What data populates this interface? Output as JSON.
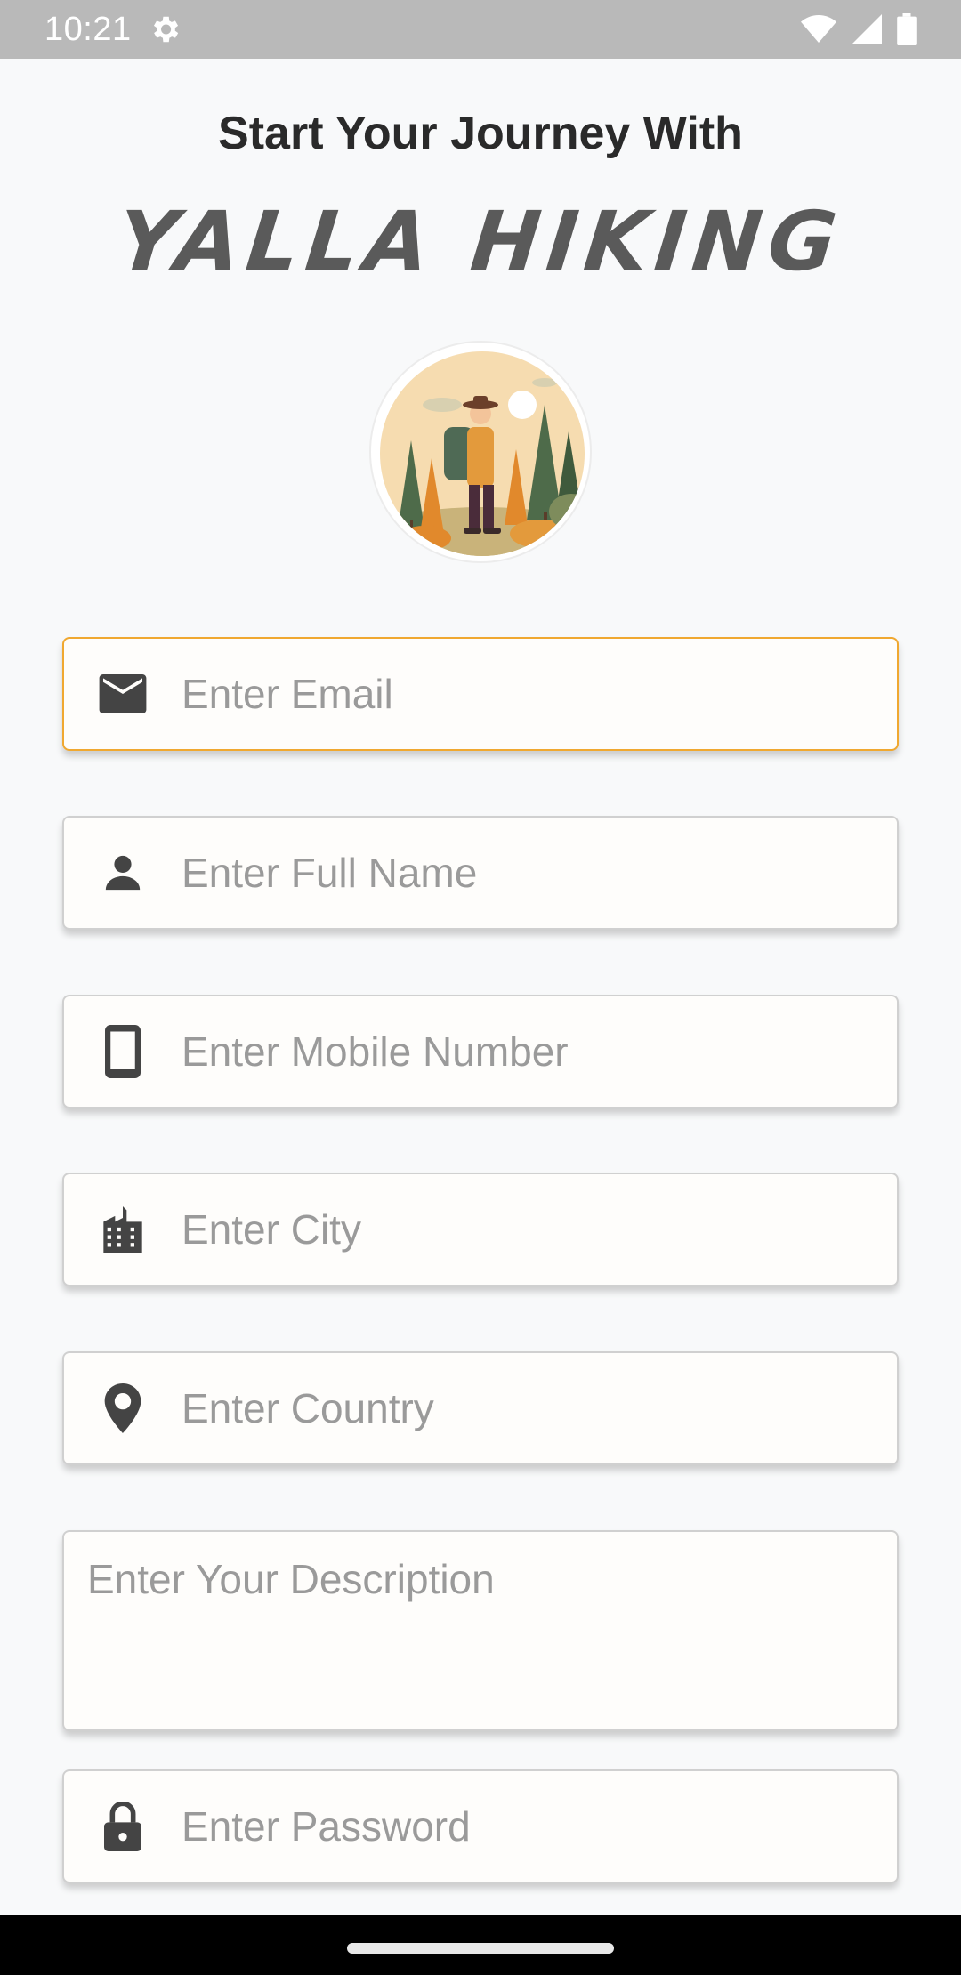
{
  "status_bar": {
    "time": "10:21",
    "icons": [
      "settings-icon",
      "wifi-icon",
      "signal-icon",
      "battery-icon"
    ]
  },
  "header": {
    "headline": "Start Your Journey With",
    "brand": "YALLA HIKING"
  },
  "avatar": {
    "description_icon": "hiker-illustration"
  },
  "form": {
    "email": {
      "placeholder": "Enter Email",
      "icon": "email-icon",
      "value": ""
    },
    "full_name": {
      "placeholder": "Enter Full Name",
      "icon": "person-icon",
      "value": ""
    },
    "mobile": {
      "placeholder": "Enter Mobile Number",
      "icon": "phone-icon",
      "value": ""
    },
    "city": {
      "placeholder": "Enter City",
      "icon": "city-icon",
      "value": ""
    },
    "country": {
      "placeholder": "Enter Country",
      "icon": "location-pin-icon",
      "value": ""
    },
    "description": {
      "placeholder": "Enter Your Description",
      "value": ""
    },
    "password": {
      "placeholder": "Enter Password",
      "icon": "lock-icon",
      "value": ""
    }
  },
  "colors": {
    "status_bar": "#b9b9b9",
    "focus_border": "#f0a830",
    "field_border": "#d0d0d0",
    "field_bg": "#fefdfb",
    "placeholder": "#9a9a9a",
    "brand_text": "#5a5a5a"
  }
}
